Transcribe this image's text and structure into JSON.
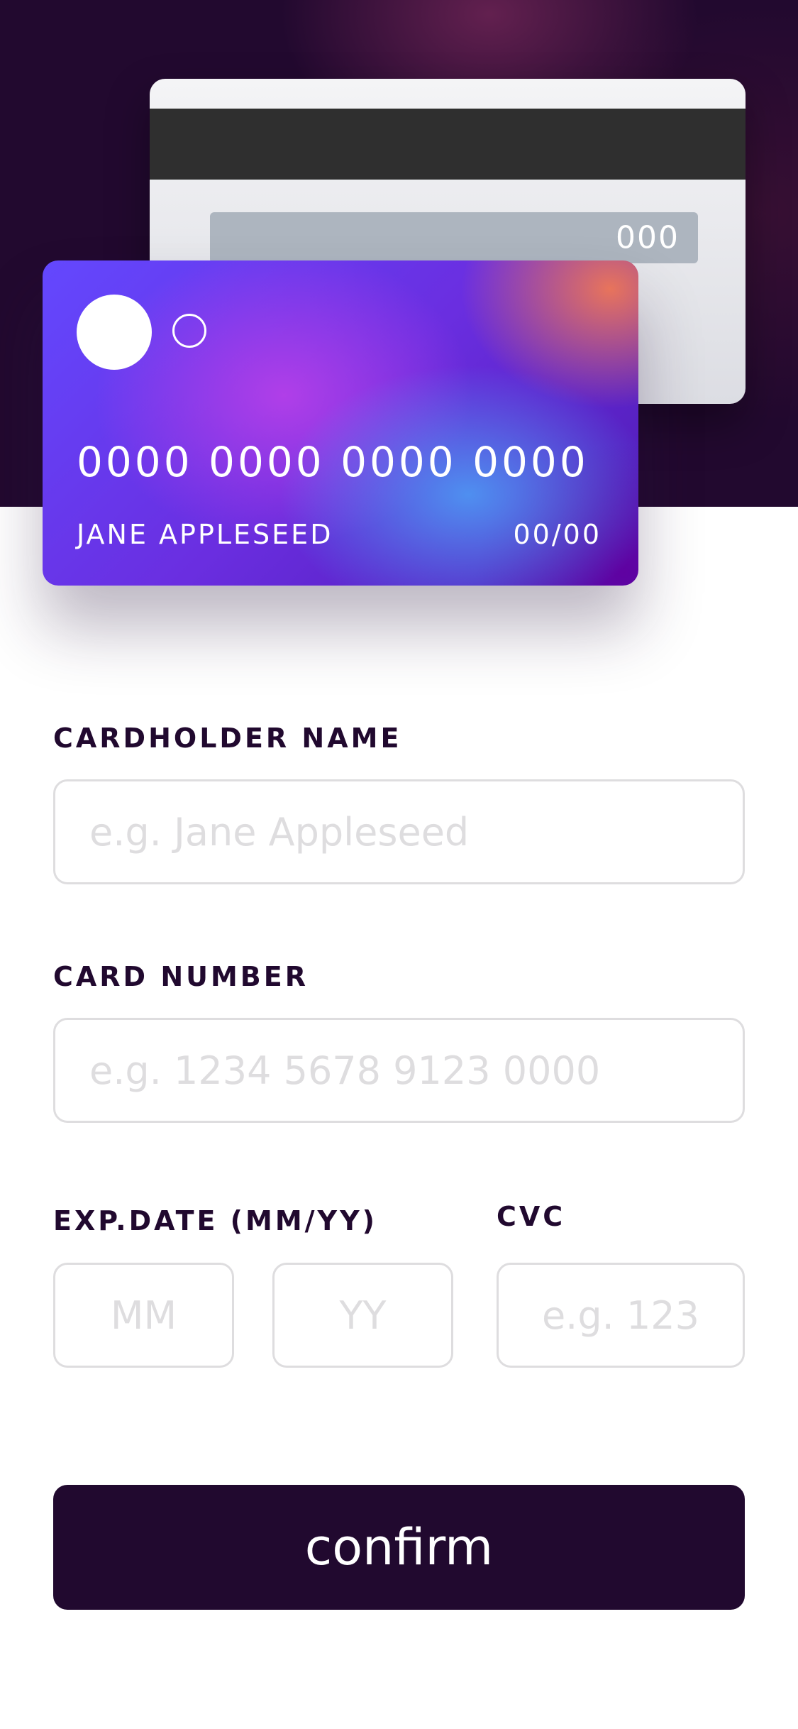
{
  "card_back": {
    "cvc": "000"
  },
  "card_front": {
    "number": "0000 0000 0000 0000",
    "name": "JANE APPLESEED",
    "expiry": "00/00"
  },
  "form": {
    "name_label": "CARDHOLDER NAME",
    "name_placeholder": "e.g. Jane Appleseed",
    "number_label": "CARD NUMBER",
    "number_placeholder": "e.g. 1234 5678 9123 0000",
    "exp_label": "EXP.DATE (MM/YY)",
    "month_placeholder": "MM",
    "year_placeholder": "YY",
    "cvc_label": "CVC",
    "cvc_placeholder": "e.g. 123",
    "confirm_label": "confirm"
  },
  "colors": {
    "dark_violet": "#21092f",
    "input_border": "#dedddf",
    "white": "#ffffff"
  }
}
